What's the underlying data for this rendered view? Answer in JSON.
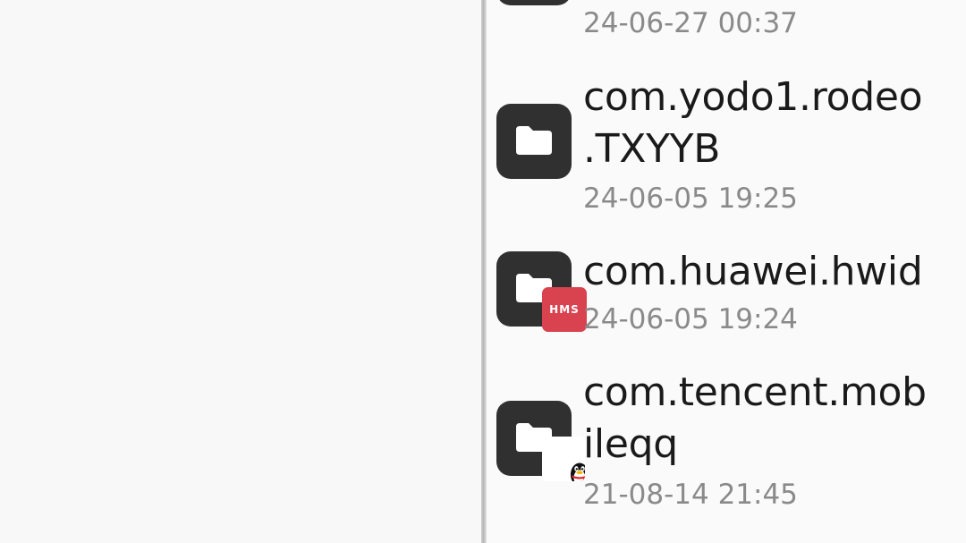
{
  "files": [
    {
      "name": "",
      "date": "24-06-27 00:37",
      "badge": "none"
    },
    {
      "name": "com.yodo1.rodeo\n.TXYYB",
      "date": "24-06-05 19:25",
      "badge": "none"
    },
    {
      "name": "com.huawei.hwid",
      "date": "24-06-05 19:24",
      "badge": "HMS"
    },
    {
      "name": "com.tencent.mob\nileqq",
      "date": "21-08-14 21:45",
      "badge": "qq"
    }
  ],
  "colors": {
    "folder_tile": "#303030",
    "hms_badge": "#d94350",
    "name_text": "#1a1a1a",
    "date_text": "#8a8a8a"
  }
}
